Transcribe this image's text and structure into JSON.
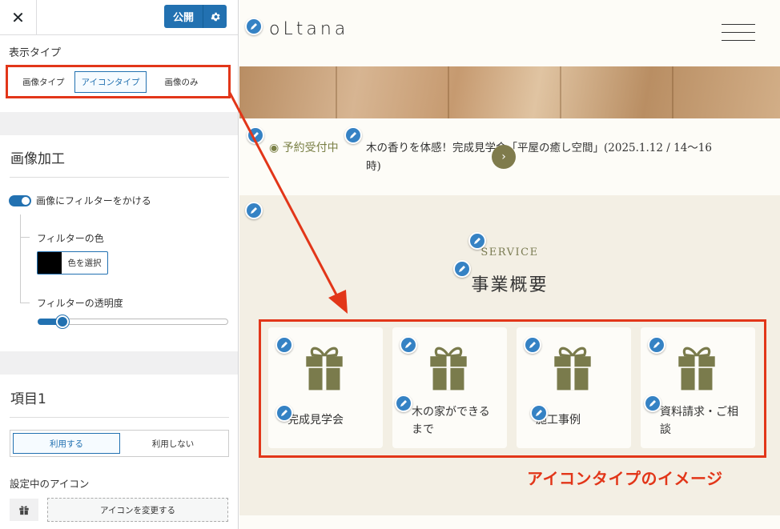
{
  "sidebar": {
    "close_label": "✕",
    "publish_label": "公開",
    "display_type_label": "表示タイプ",
    "display_types": [
      "画像タイプ",
      "アイコンタイプ",
      "画像のみ"
    ],
    "image_processing_title": "画像加工",
    "filter_toggle_label": "画像にフィルターをかける",
    "filter_color_label": "フィルターの色",
    "color_select_label": "色を選択",
    "filter_color_value": "#000000",
    "filter_opacity_label": "フィルターの透明度",
    "filter_opacity_value": 0.13,
    "item_title": "項目1",
    "use_options": [
      "利用する",
      "利用しない"
    ],
    "current_icon_label": "設定中のアイコン",
    "change_icon_label": "アイコンを変更する",
    "accent_color": "#2271b1"
  },
  "preview": {
    "logo": "oLtana",
    "news": {
      "tag": "◉ 予約受付中",
      "text": "木の香りを体感！完成見学会「平屋の癒し空間」(2025.1.12 / 14〜16時)"
    },
    "service": {
      "subtitle": "SERVICE",
      "title": "事業概要",
      "cards": [
        {
          "label": "完成見学会",
          "icon": "gift-icon"
        },
        {
          "label": "木の家ができるまで",
          "icon": "gift-icon"
        },
        {
          "label": "施工事例",
          "icon": "gift-icon"
        },
        {
          "label": "資料請求・ご相談",
          "icon": "gift-icon"
        }
      ]
    },
    "theme_color": "#7a7b4c"
  },
  "annotation": {
    "caption": "アイコンタイプのイメージ",
    "color": "#e23619"
  }
}
